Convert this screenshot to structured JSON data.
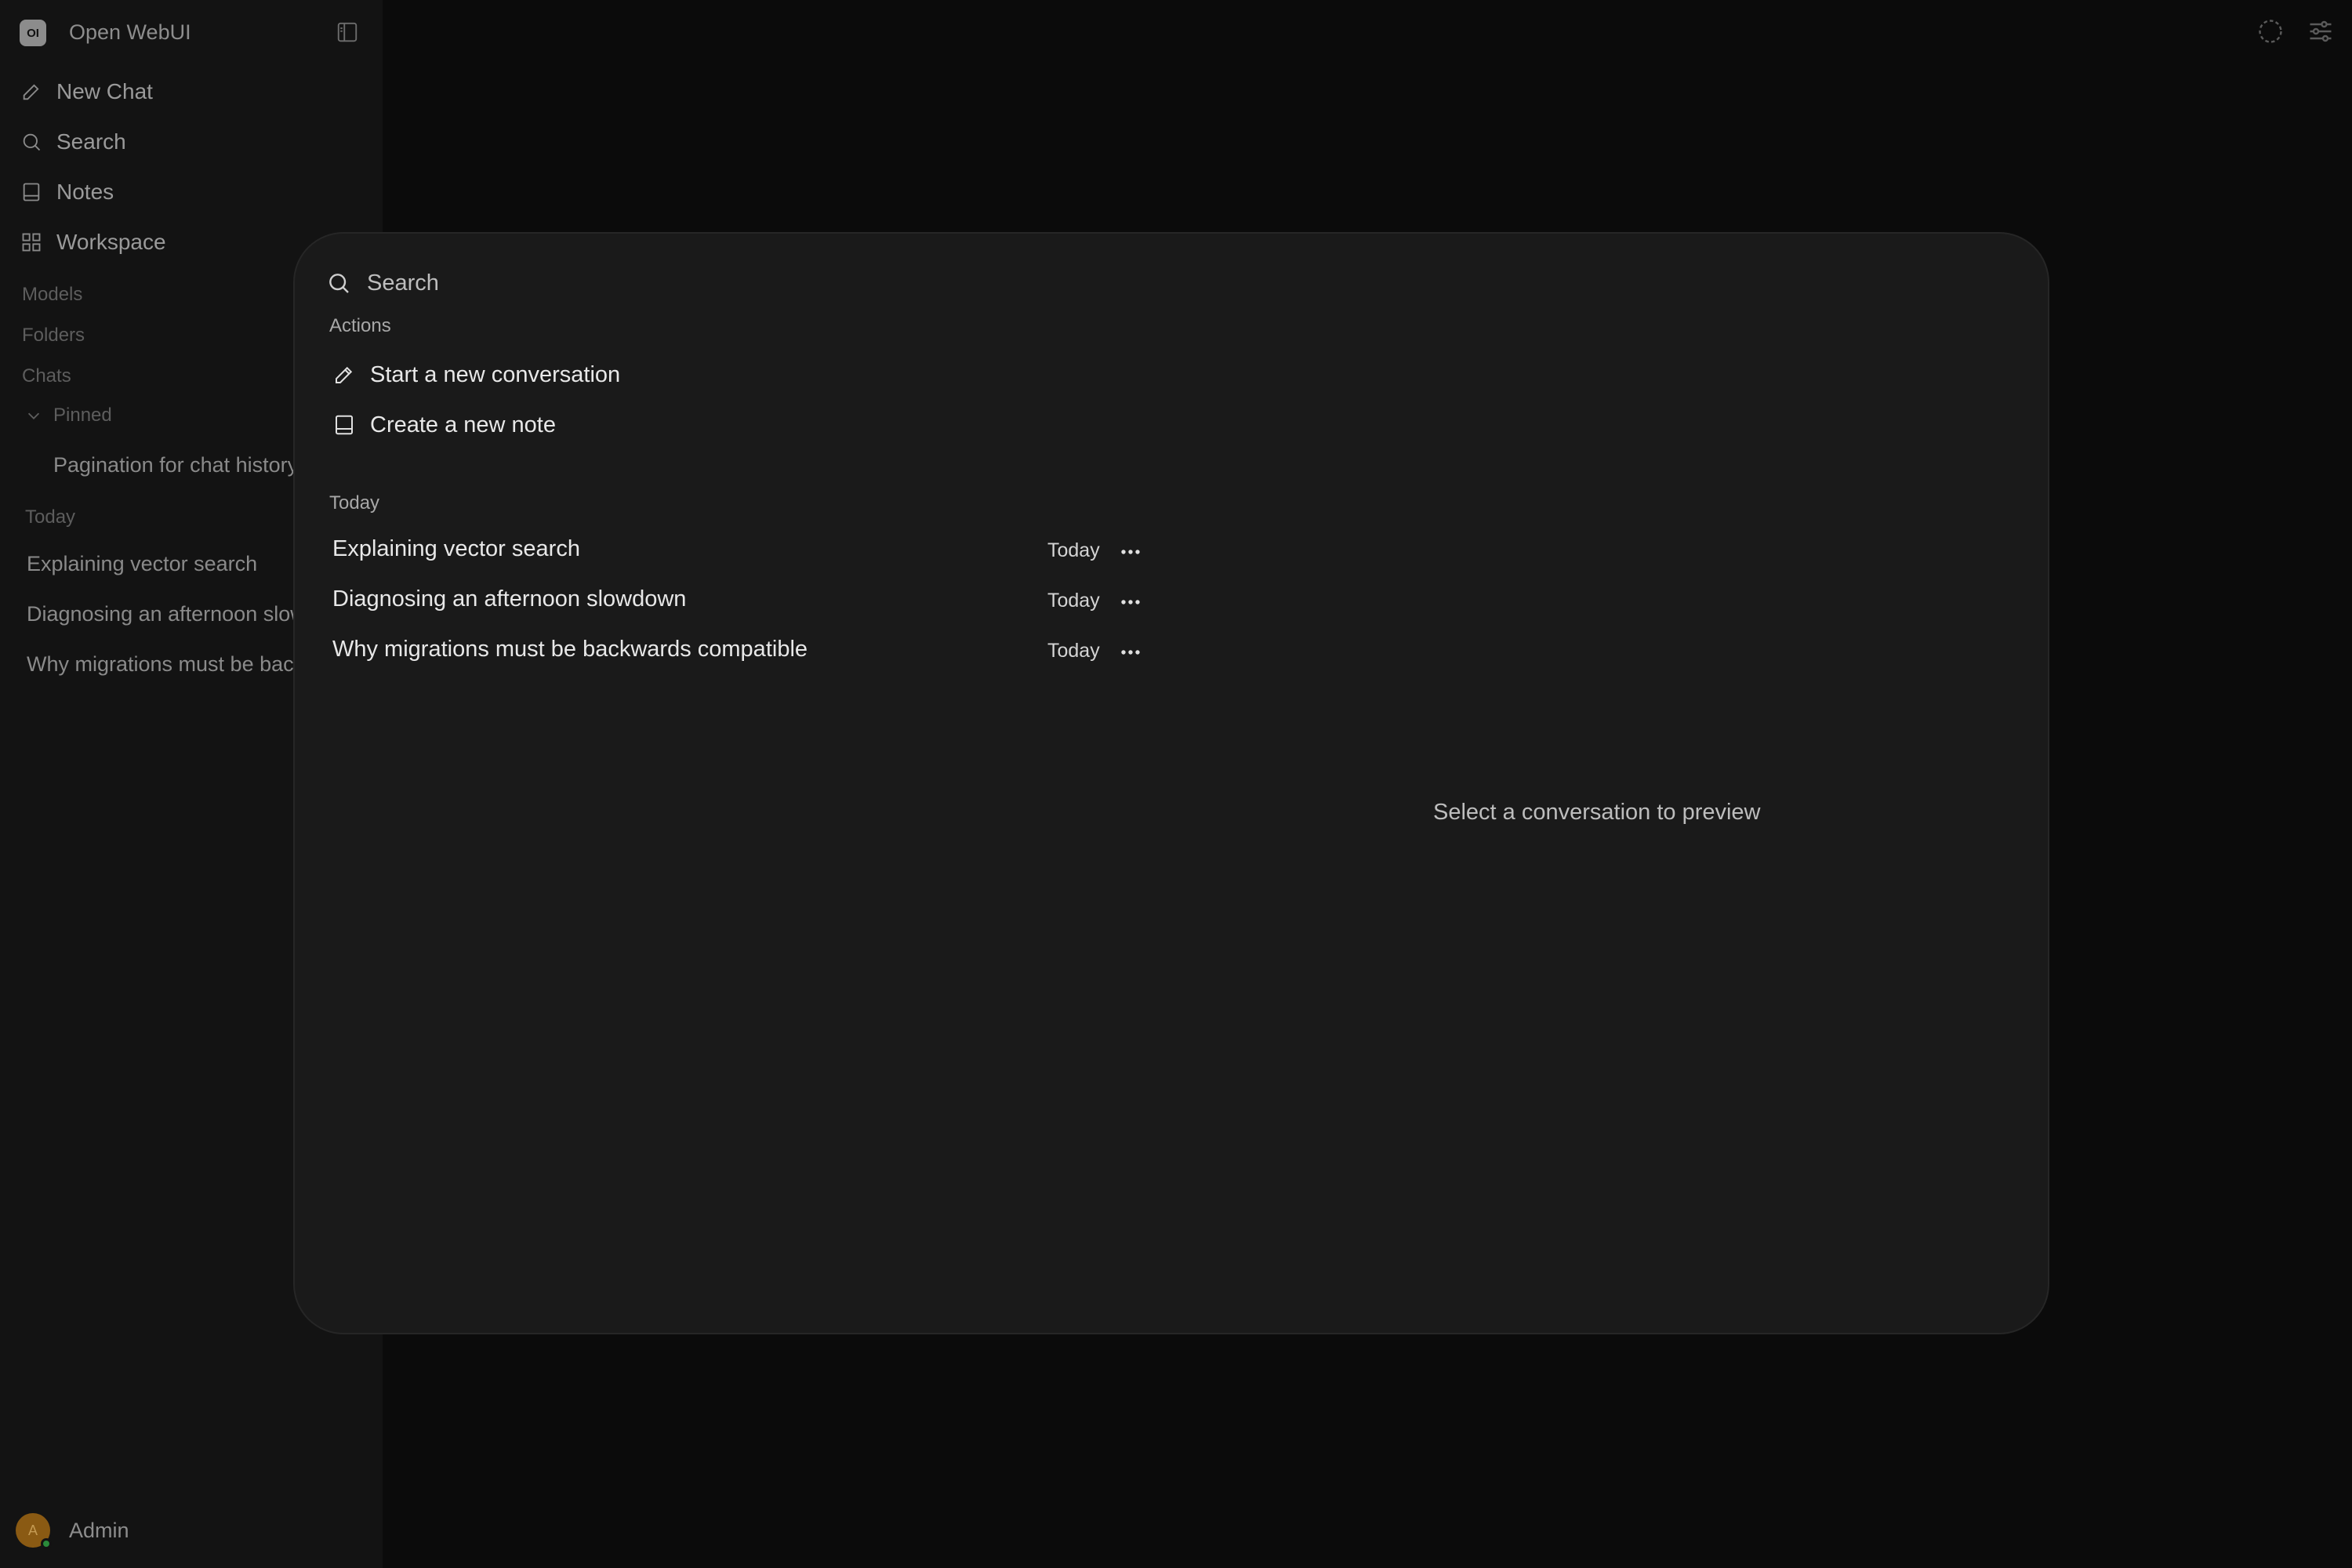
{
  "app": {
    "logo_text": "OI",
    "title": "Open WebUI"
  },
  "sidebar": {
    "nav": [
      {
        "label": "New Chat",
        "icon": "pencil-icon"
      },
      {
        "label": "Search",
        "icon": "search-icon"
      },
      {
        "label": "Notes",
        "icon": "note-icon"
      },
      {
        "label": "Workspace",
        "icon": "grid-icon"
      }
    ],
    "sections": {
      "models": "Models",
      "folders": "Folders",
      "chats": "Chats",
      "pinned": "Pinned",
      "today": "Today"
    },
    "pinned_items": [
      "Pagination for chat history"
    ],
    "today_items": [
      "Explaining vector search",
      "Diagnosing an afternoon slowdown",
      "Why migrations must be backwards compatible"
    ],
    "user": {
      "avatar_letter": "A",
      "name": "Admin"
    }
  },
  "modal": {
    "search_placeholder": "Search",
    "actions_heading": "Actions",
    "actions": [
      {
        "label": "Start a new conversation",
        "icon": "pencil-icon"
      },
      {
        "label": "Create a new note",
        "icon": "note-icon"
      }
    ],
    "today_heading": "Today",
    "results": [
      {
        "title": "Explaining vector search",
        "date": "Today"
      },
      {
        "title": "Diagnosing an afternoon slowdown",
        "date": "Today"
      },
      {
        "title": "Why migrations must be backwards compatible",
        "date": "Today"
      }
    ],
    "preview_placeholder": "Select a conversation to preview"
  },
  "colors": {
    "background": "#0b0b0b",
    "sidebar": "#131313",
    "modal": "#1a1a1a",
    "text_primary": "#e8e8e8",
    "text_muted": "#8a8a8a"
  }
}
